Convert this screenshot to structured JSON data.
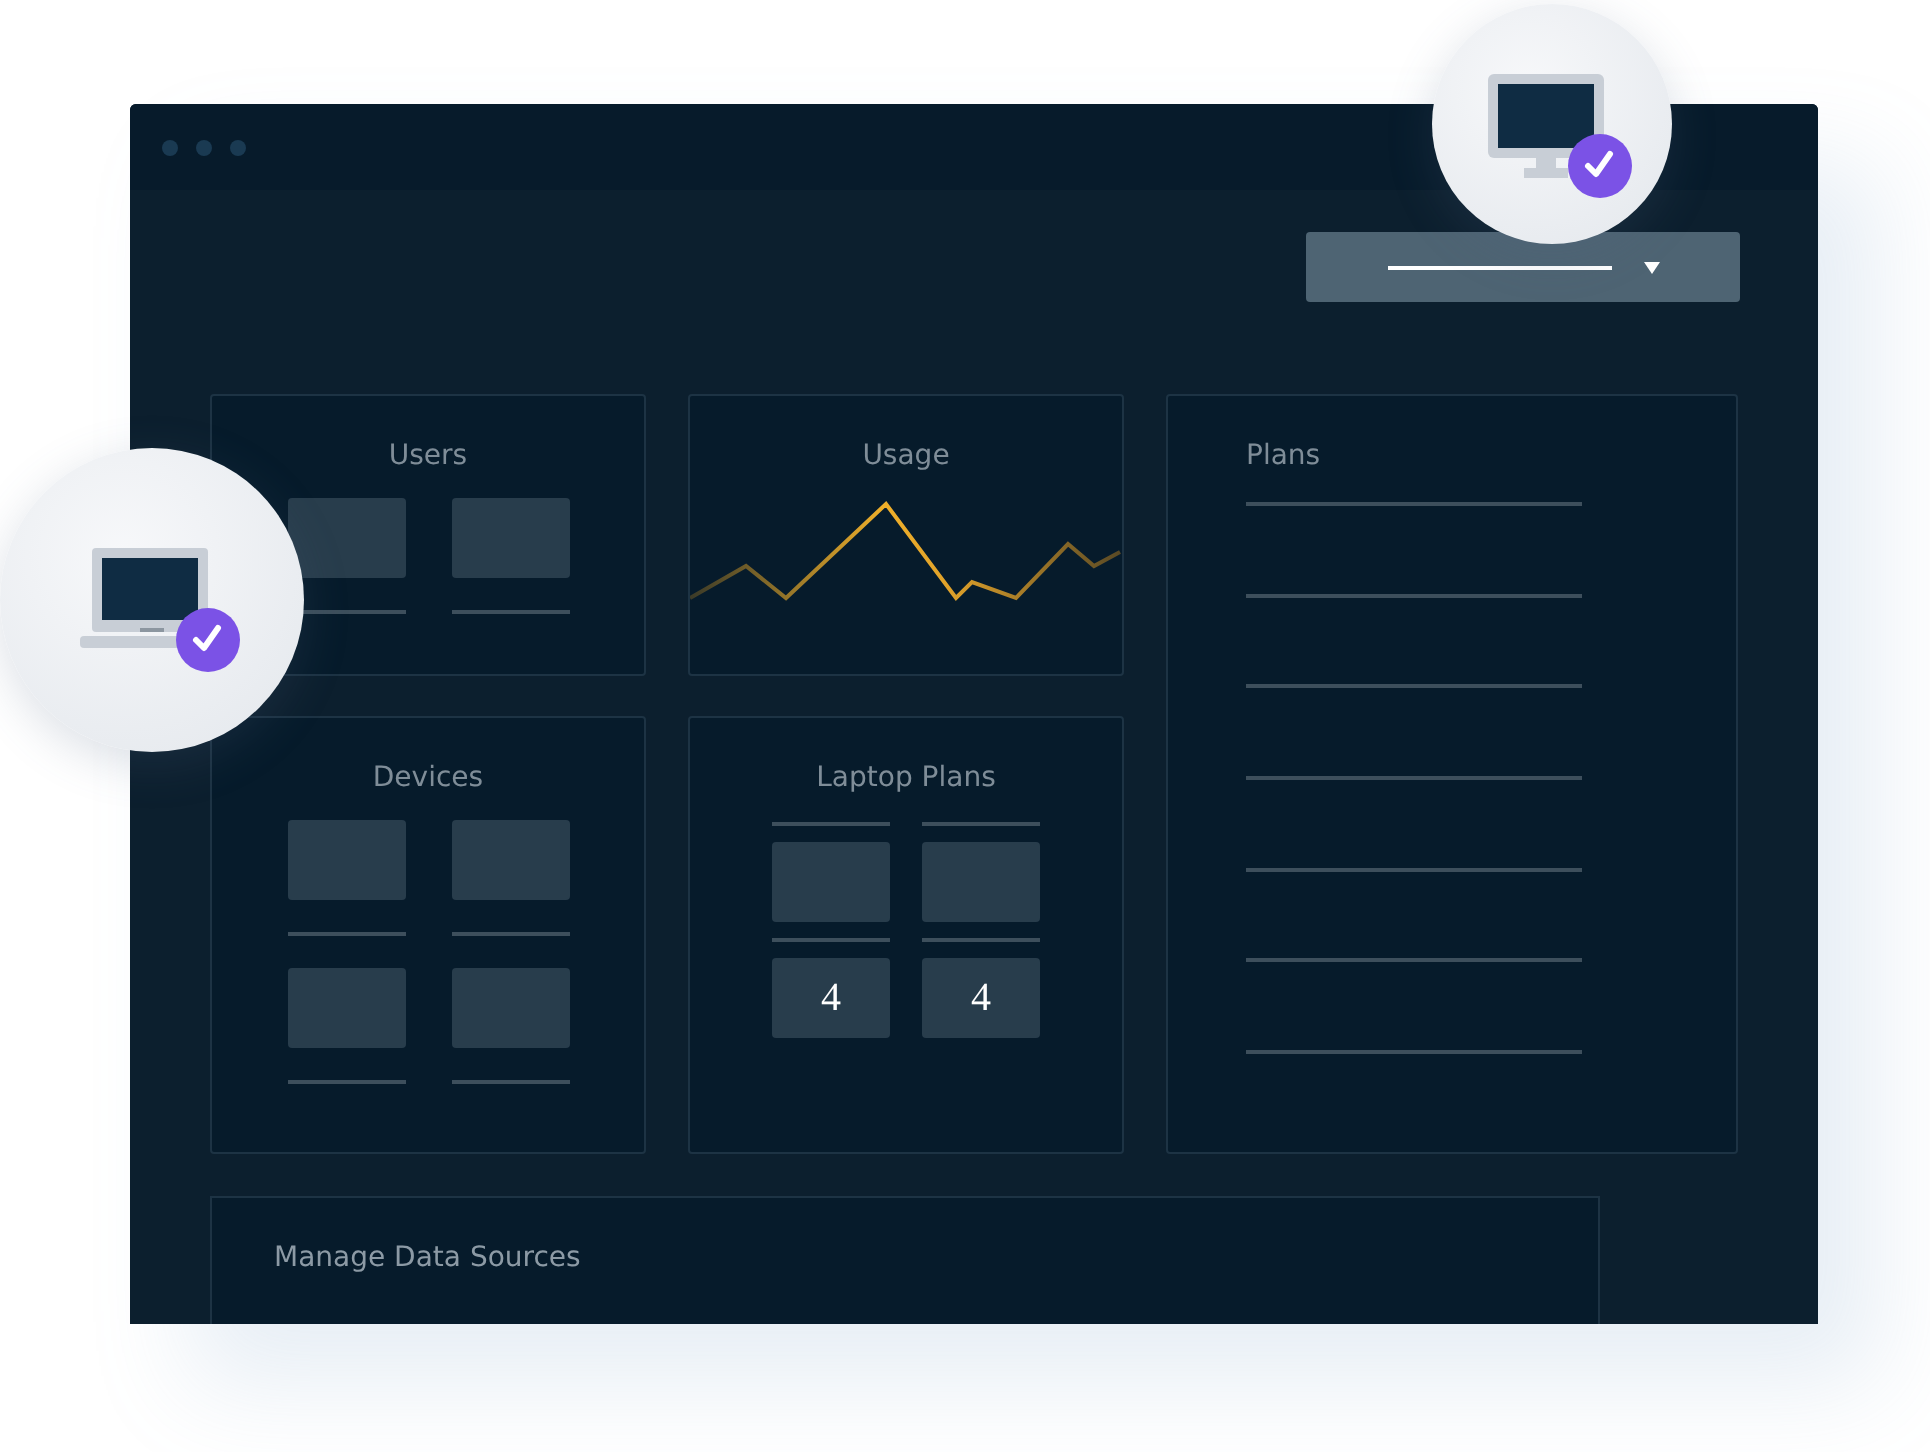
{
  "cards": [
    {
      "title": "Users",
      "kind": "tile-row"
    },
    {
      "title": "Usage",
      "kind": "sparkline"
    },
    {
      "title": "Plans",
      "kind": "line-list"
    },
    {
      "title": "Devices",
      "kind": "tile-grid"
    },
    {
      "title": "Laptop Plans",
      "kind": "stat-tiles",
      "values": [
        "4",
        "4"
      ]
    }
  ],
  "footer_card": {
    "title": "Manage Data Sources"
  }
}
